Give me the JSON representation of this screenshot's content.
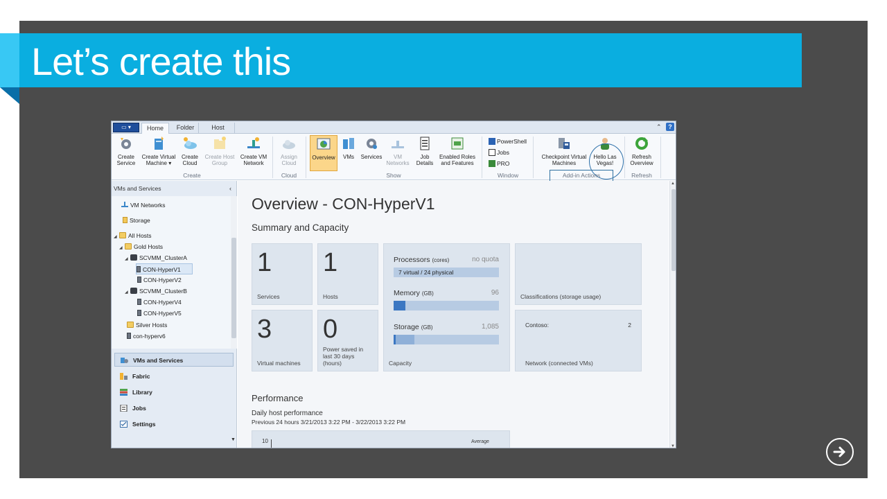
{
  "slide": {
    "title": "Let’s create this",
    "colors": {
      "banner": "#0aaee0",
      "panel": "#4b4b4b",
      "accent": "#38c8f4"
    },
    "next_icon": "arrow-right-circle-icon"
  },
  "app": {
    "tabs": {
      "home": "Home",
      "folder": "Folder",
      "host": "Host"
    },
    "window_controls": {
      "collapse": "⌃",
      "help": "?"
    },
    "ribbon": {
      "groups": {
        "create": "Create",
        "cloud": "Cloud",
        "show": "Show",
        "window": "Window",
        "addin": "Add-in Actions",
        "refresh": "Refresh"
      },
      "buttons": {
        "create_service": "Create Service",
        "create_vm": "Create Virtual Machine ▾",
        "create_cloud": "Create Cloud",
        "create_host_group": "Create Host Group",
        "create_vm_network": "Create VM Network",
        "assign_cloud": "Assign Cloud",
        "overview": "Overview",
        "vms": "VMs",
        "services": "Services",
        "vm_networks": "VM Networks",
        "job_details": "Job Details",
        "enabled_roles": "Enabled Roles and Features",
        "powershell": "PowerShell",
        "jobs": "Jobs",
        "pro": "PRO",
        "checkpoint_vms": "Checkpoint Virtual Machines",
        "hello_las_vegas": "Hello Las Vegas!",
        "refresh_overview": "Refresh Overview"
      }
    },
    "sidebar": {
      "header": "VMs and Services",
      "collapse_icon": "‹",
      "tree": [
        {
          "label": "VM Networks"
        },
        {
          "label": "Storage"
        },
        {
          "label": "All Hosts"
        },
        {
          "label": "Gold Hosts"
        },
        {
          "label": "SCVMM_ClusterA"
        },
        {
          "label": "CON-HyperV1",
          "selected": true
        },
        {
          "label": "CON-HyperV2"
        },
        {
          "label": "SCVMM_ClusterB"
        },
        {
          "label": "CON-HyperV4"
        },
        {
          "label": "CON-HyperV5"
        },
        {
          "label": "Silver Hosts"
        },
        {
          "label": "con-hyperv6"
        }
      ],
      "workspaces": {
        "vms_services": "VMs and Services",
        "fabric": "Fabric",
        "library": "Library",
        "jobs": "Jobs",
        "settings": "Settings"
      }
    },
    "main": {
      "title": "Overview - CON-HyperV1",
      "summary_title": "Summary and Capacity",
      "tiles": {
        "services": {
          "value": "1",
          "label": "Services"
        },
        "hosts": {
          "value": "1",
          "label": "Hosts"
        },
        "vms": {
          "value": "3",
          "label": "Virtual machines"
        },
        "power": {
          "value": "0",
          "label": "Power saved in last 30 days (hours)"
        }
      },
      "capacity": {
        "label": "Capacity",
        "processors": {
          "label": "Processors",
          "unit": "(cores)",
          "value": "no quota",
          "bar_text": "7 virtual / 24 physical",
          "fill": 0
        },
        "memory": {
          "label": "Memory",
          "unit": "(GB)",
          "value": "96",
          "fill": 0.11
        },
        "storage": {
          "label": "Storage",
          "unit": "(GB)",
          "value": "1,085",
          "fill": 0.2,
          "fill_marker": 0.02
        }
      },
      "classifications": {
        "label": "Classifications (storage usage)"
      },
      "network": {
        "name": "Contoso:",
        "count": "2",
        "label": "Network (connected VMs)"
      },
      "performance": {
        "title": "Performance",
        "subtitle": "Daily host performance",
        "range": "Previous 24 hours  3/21/2013 3:22 PM - 3/22/2013 3:22 PM",
        "y_top": "10",
        "legend": "Average"
      }
    }
  }
}
